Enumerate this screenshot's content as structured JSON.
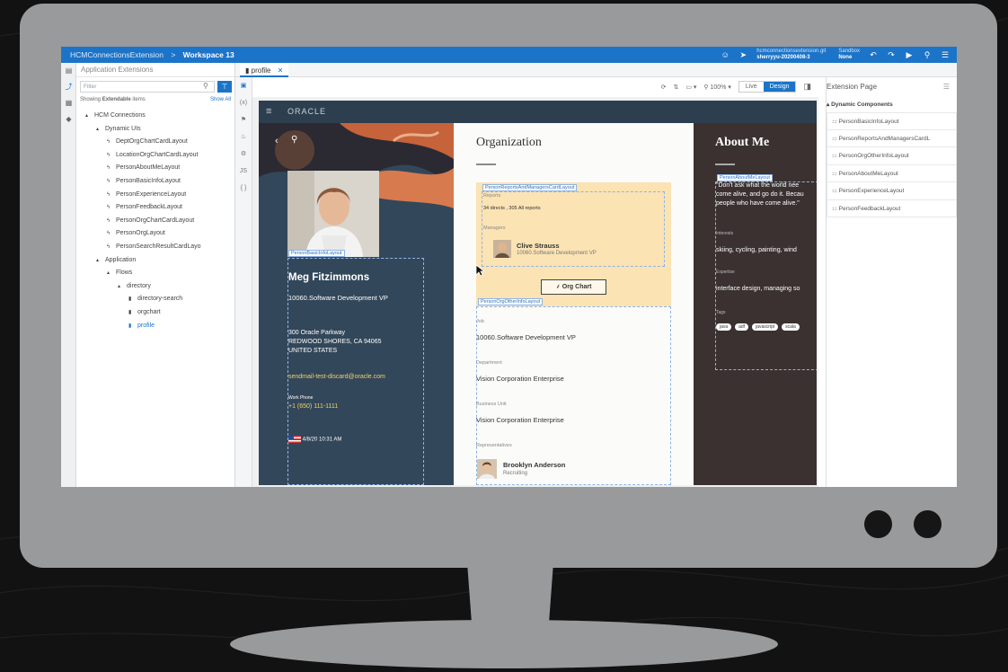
{
  "breadcrumb": {
    "project": "HCMConnectionsExtension",
    "separator": ">",
    "workspace": "Workspace 13"
  },
  "topbar": {
    "git_label": "hcmconnectionsextension.git",
    "branch": "sherryyu-20200408-3",
    "sandbox_label": "Sandbox",
    "sandbox_value": "None"
  },
  "panel": {
    "title": "Application Extensions",
    "filter_placeholder": "Filter",
    "showing_prefix": "Showing",
    "showing_bold": "Extendable",
    "showing_suffix": "items",
    "show_all": "Show All",
    "tree": [
      {
        "label": "HCM Connections",
        "indent": 0,
        "icon": "▴"
      },
      {
        "label": "Dynamic UIs",
        "indent": 1,
        "icon": "▴"
      },
      {
        "label": "DeptOrgChartCardLayout",
        "indent": 2,
        "icon": "ϟ"
      },
      {
        "label": "LocationOrgChartCardLayout",
        "indent": 2,
        "icon": "ϟ"
      },
      {
        "label": "PersonAboutMeLayout",
        "indent": 2,
        "icon": "ϟ"
      },
      {
        "label": "PersonBasicInfoLayout",
        "indent": 2,
        "icon": "ϟ"
      },
      {
        "label": "PersonExperienceLayout",
        "indent": 2,
        "icon": "ϟ"
      },
      {
        "label": "PersonFeedbackLayout",
        "indent": 2,
        "icon": "ϟ"
      },
      {
        "label": "PersonOrgChartCardLayout",
        "indent": 2,
        "icon": "ϟ"
      },
      {
        "label": "PersonOrgLayout",
        "indent": 2,
        "icon": "ϟ"
      },
      {
        "label": "PersonSearchResultCardLayo",
        "indent": 2,
        "icon": "ϟ"
      },
      {
        "label": "Application",
        "indent": 1,
        "icon": "▴"
      },
      {
        "label": "Flows",
        "indent": 2,
        "icon": "▴"
      },
      {
        "label": "directory",
        "indent": 3,
        "icon": "▴"
      },
      {
        "label": "directory-search",
        "indent": 4,
        "icon": "▮"
      },
      {
        "label": "orgchart",
        "indent": 4,
        "icon": "▮"
      },
      {
        "label": "profile",
        "indent": 4,
        "icon": "▮"
      }
    ]
  },
  "tab": {
    "label": "profile",
    "close": "✕"
  },
  "toolbar": {
    "zoom": "100%",
    "live": "Live",
    "design": "Design"
  },
  "preview": {
    "brand": "ORACLE",
    "basic": {
      "tag": "PersonBasicInfoLayout",
      "name": "Meg Fitzimmons",
      "title": "10060.Software Development VP",
      "address1": "300 Oracle Parkway",
      "address2": "REDWOOD SHORES, CA 94065",
      "address3": "UNITED STATES",
      "email": "sendmail-test-discard@oracle.com",
      "phone_label": "Work Phone",
      "phone": "+1 (650) 111-1111",
      "local_time": "4/8/20 10:31 AM"
    },
    "org": {
      "heading": "Organization",
      "reports_tag": "PersonReportsAndManagersCardLayout",
      "reports_label": "Reports",
      "reports_value": "34 directs , 305 All reports",
      "managers_label": "Managers",
      "manager_name": "Clive Strauss",
      "manager_title": "10060.Software Development VP",
      "org_chart_button": "Org Chart",
      "other_tag": "PersonOrgOtherInfoLayout",
      "job_label": "Job",
      "job": "10060.Software Development VP",
      "department_label": "Department",
      "department": "Vision Corporation Enterprise",
      "bu_label": "Business Unit",
      "bu": "Vision Corporation Enterprise",
      "rep_label": "Representatives",
      "rep_name": "Brooklyn Anderson",
      "rep_role": "Recruiting"
    },
    "about": {
      "heading": "About Me",
      "tag": "PersonAboutMeLayout",
      "quote1": "\"Don't ask what the world nee",
      "quote2": "come alive, and go do it. Becau",
      "quote3": "people who have come alive.\"",
      "interests_label": "Interests",
      "interests": "skiing, cycling, painting, wind",
      "expertise_label": "Expertise",
      "expertise": "interface design, managing so",
      "tags_label": "Tags",
      "tags": [
        "java",
        "adf",
        "javascript",
        "scala"
      ]
    }
  },
  "extension": {
    "title": "Extension Page",
    "section": "Dynamic Components",
    "items": [
      "PersonBasicInfoLayout",
      "PersonReportsAndManagersCardL",
      "PersonOrgOtherInfoLayout",
      "PersonAboutMeLayout",
      "PersonExperienceLayout",
      "PersonFeedbackLayout"
    ]
  }
}
